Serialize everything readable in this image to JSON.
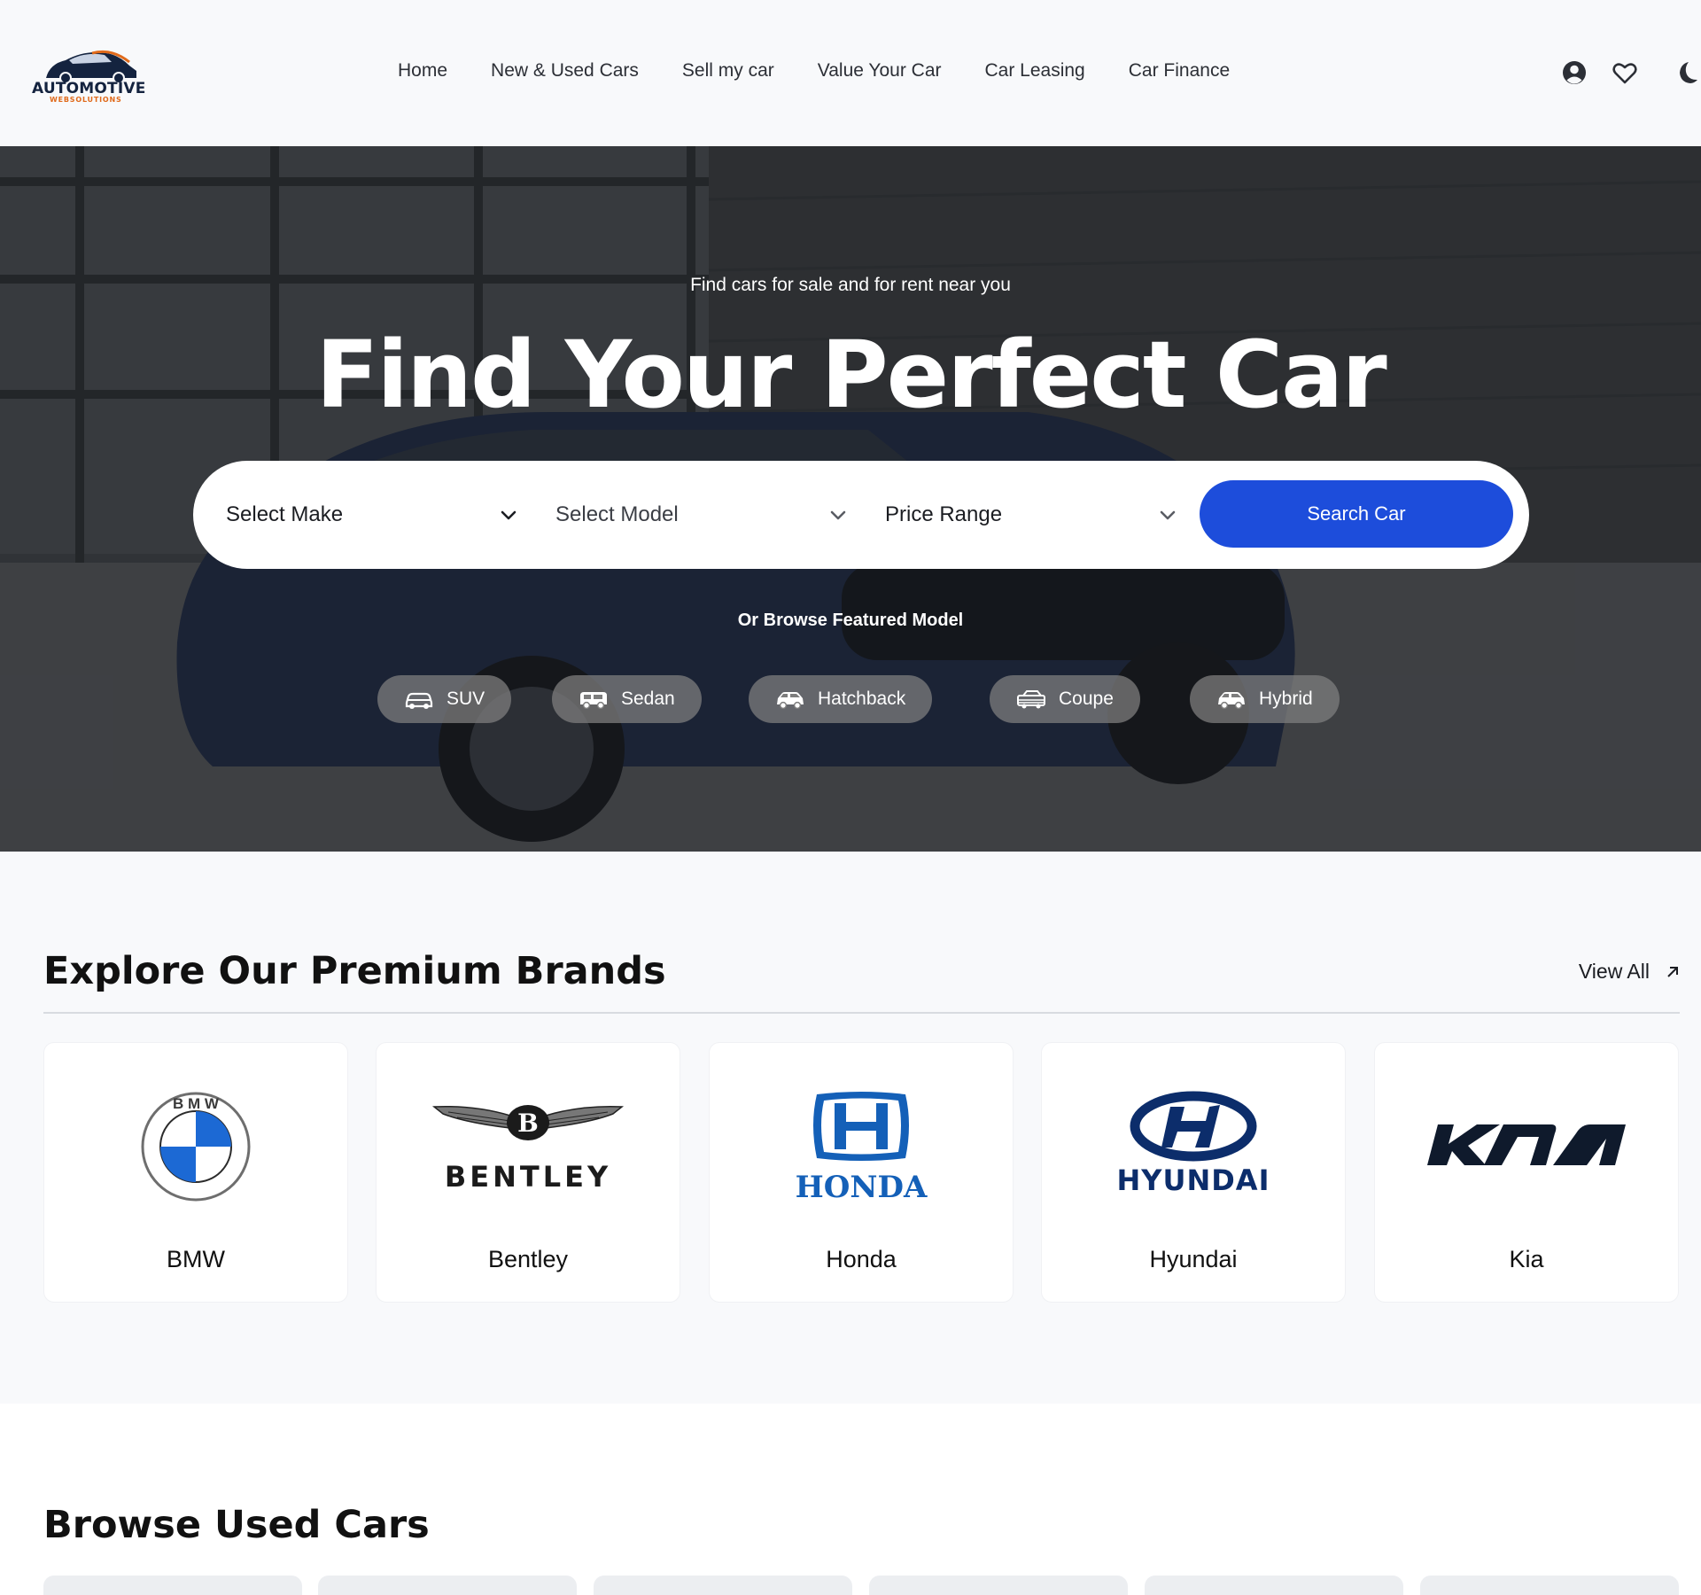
{
  "header": {
    "logo": {
      "word": "AUTOMOTIVE",
      "sub": "WEBSOLUTIONS"
    },
    "nav": [
      "Home",
      "New & Used Cars",
      "Sell my car",
      "Value Your Car",
      "Car Leasing",
      "Car Finance"
    ],
    "icons": [
      "user-circle-icon",
      "heart-icon",
      "moon-icon"
    ]
  },
  "hero": {
    "subtitle": "Find cars for sale and for rent near you",
    "title": "Find Your Perfect Car",
    "search": {
      "make": "Select Make",
      "model": "Select Model",
      "price": "Price Range",
      "button": "Search Car"
    },
    "browse_label": "Or Browse Featured Model",
    "chips": [
      {
        "label": "SUV",
        "icon": "suv-icon"
      },
      {
        "label": "Sedan",
        "icon": "sedan-icon"
      },
      {
        "label": "Hatchback",
        "icon": "hatchback-icon"
      },
      {
        "label": "Coupe",
        "icon": "coupe-icon"
      },
      {
        "label": "Hybrid",
        "icon": "hybrid-icon"
      }
    ]
  },
  "brands": {
    "title": "Explore Our Premium Brands",
    "view_all": "View All",
    "items": [
      {
        "name": "BMW",
        "logo_text": "B M W"
      },
      {
        "name": "Bentley",
        "logo_text": "BENTLEY"
      },
      {
        "name": "Honda",
        "logo_text": "HONDA"
      },
      {
        "name": "Hyundai",
        "logo_text": "HYUNDAI"
      },
      {
        "name": "Kia",
        "logo_text": "KIA"
      }
    ]
  },
  "used_cars": {
    "title": "Browse Used Cars"
  },
  "colors": {
    "accent": "#1d4ddb",
    "header_bg": "#f8f9fb",
    "brands_bg": "#f8f9fb",
    "logo_navy": "#14233f",
    "logo_orange": "#e06a1b",
    "honda_blue": "#1460b8",
    "hyundai_navy": "#0c2d6b",
    "kia_navy": "#0f1a2c"
  }
}
